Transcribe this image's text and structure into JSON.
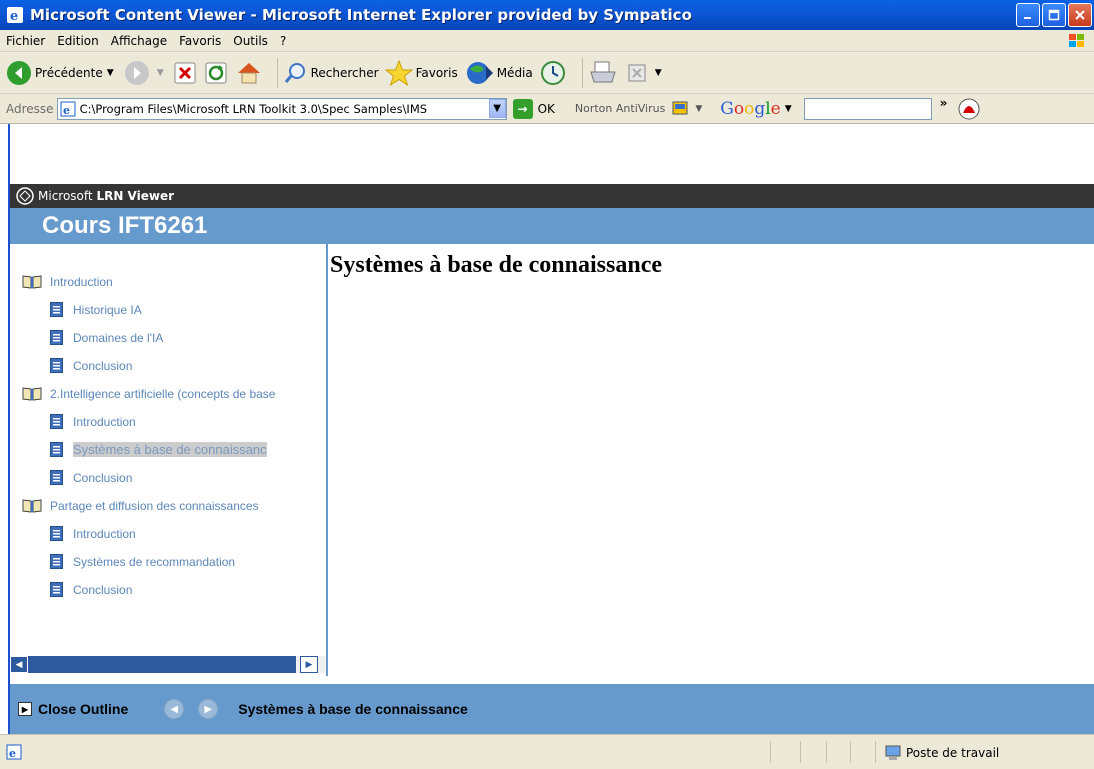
{
  "window": {
    "title": "Microsoft Content Viewer - Microsoft Internet Explorer provided by Sympatico"
  },
  "menu": [
    "Fichier",
    "Edition",
    "Affichage",
    "Favoris",
    "Outils",
    "?"
  ],
  "toolbar": {
    "back_label": "Précédente",
    "search_label": "Rechercher",
    "favorites_label": "Favoris",
    "media_label": "Média"
  },
  "address": {
    "label": "Adresse",
    "value": "C:\\Program Files\\Microsoft LRN Toolkit 3.0\\Spec Samples\\IMS",
    "go_label": "OK",
    "norton_label": "Norton AntiVirus",
    "google_label": "Google"
  },
  "viewer": {
    "brand_prefix": "Microsoft ",
    "brand_bold": "LRN Viewer",
    "course_title": "Cours IFT6261"
  },
  "outline": {
    "items": [
      {
        "label": "Introduction",
        "type": "book"
      },
      {
        "label": "Historique IA",
        "type": "page"
      },
      {
        "label": "Domaines de l'IA",
        "type": "page"
      },
      {
        "label": "Conclusion",
        "type": "page"
      },
      {
        "label": "2.Intelligence artificielle (concepts de base",
        "type": "book"
      },
      {
        "label": "Introduction",
        "type": "page"
      },
      {
        "label": "Systèmes à base de connaissanc",
        "type": "page",
        "selected": true
      },
      {
        "label": "Conclusion",
        "type": "page"
      },
      {
        "label": "Partage et diffusion des connaissances",
        "type": "book"
      },
      {
        "label": "Introduction",
        "type": "page"
      },
      {
        "label": "Systèmes de recommandation",
        "type": "page"
      },
      {
        "label": "Conclusion",
        "type": "page"
      }
    ]
  },
  "content": {
    "heading": "Systèmes à base de connaissance"
  },
  "navbar": {
    "close_outline_label": "Close Outline",
    "current_title": "Systèmes à base de connaissance"
  },
  "status": {
    "zone_label": "Poste de travail"
  },
  "colors": {
    "titlebar": "#0a58d8",
    "viewer_blue": "#6699cc",
    "outline_text": "#5b87b8"
  }
}
